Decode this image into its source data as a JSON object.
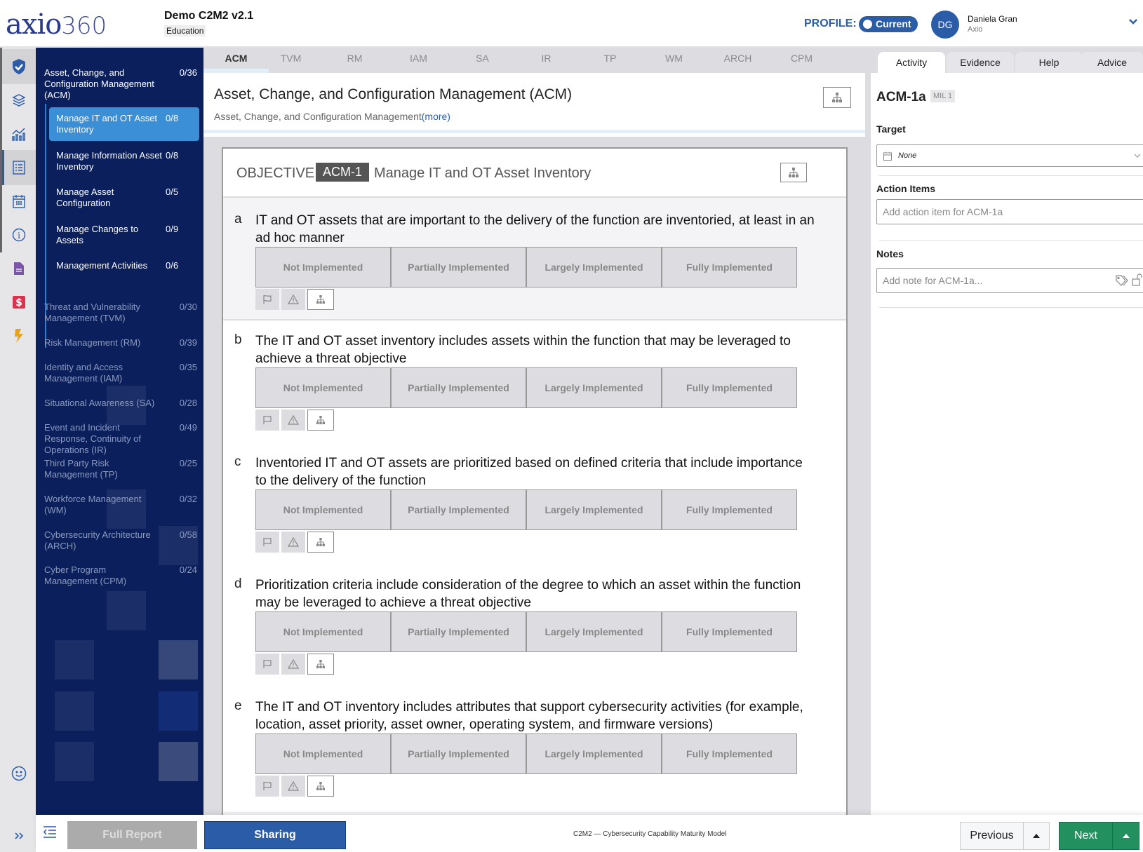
{
  "header": {
    "logo_main": "axio",
    "logo_num": "360",
    "project_title": "Demo C2M2 v2.1",
    "project_tag": "Education",
    "profile_label": "PROFILE:",
    "profile_value": "Current",
    "user_initials": "DG",
    "user_name": "Daniela Gran",
    "user_org": "Axio"
  },
  "rail": {
    "icons": [
      "shield-check-icon",
      "layers-icon",
      "chart-icon",
      "checklist-icon",
      "calendar-icon",
      "info-icon",
      "document-icon",
      "dollar-icon",
      "bolt-icon",
      "smiley-icon",
      "expand-icon"
    ]
  },
  "sidenav": {
    "active_domain": {
      "label": "Asset, Change, and Configuration Management (ACM)",
      "count": "0/36"
    },
    "objectives": [
      {
        "label": "Manage IT and OT Asset Inventory",
        "count": "0/8",
        "active": true
      },
      {
        "label": "Manage Information Asset Inventory",
        "count": "0/8"
      },
      {
        "label": "Manage Asset Configuration",
        "count": "0/5"
      },
      {
        "label": "Manage Changes to Assets",
        "count": "0/9"
      },
      {
        "label": "Management Activities",
        "count": "0/6"
      }
    ],
    "domains": [
      {
        "label": "Threat and Vulnerability Management (TVM)",
        "count": "0/30"
      },
      {
        "label": "Risk Management (RM)",
        "count": "0/39"
      },
      {
        "label": "Identity and Access Management (IAM)",
        "count": "0/35"
      },
      {
        "label": "Situational Awareness (SA)",
        "count": "0/28"
      },
      {
        "label": "Event and Incident Response, Continuity of Operations (IR)",
        "count": "0/49"
      },
      {
        "label": "Third Party Risk Management (TP)",
        "count": "0/25"
      },
      {
        "label": "Workforce Management (WM)",
        "count": "0/32"
      },
      {
        "label": "Cybersecurity Architecture (ARCH)",
        "count": "0/58"
      },
      {
        "label": "Cyber Program Management (CPM)",
        "count": "0/24"
      }
    ]
  },
  "tabs": [
    "ACM",
    "TVM",
    "RM",
    "IAM",
    "SA",
    "IR",
    "TP",
    "WM",
    "ARCH",
    "CPM"
  ],
  "active_tab": "ACM",
  "main": {
    "title": "Asset, Change, and Configuration Management (ACM)",
    "subtitle": "Asset, Change, and Configuration Management",
    "more_link": "(more)",
    "objective_label": "OBJECTIVE",
    "objective_code": "ACM-1",
    "objective_name": "Manage IT and OT Asset Inventory",
    "response_options": [
      "Not Implemented",
      "Partially Implemented",
      "Largely Implemented",
      "Fully Implemented"
    ],
    "practices": [
      {
        "letter": "a",
        "text": "IT and OT assets that are important to the delivery of the function are inventoried, at least in an ad hoc manner"
      },
      {
        "letter": "b",
        "text": "The IT and OT asset inventory includes assets within the function that may be leveraged to achieve a threat objective"
      },
      {
        "letter": "c",
        "text": "Inventoried IT and OT assets are prioritized based on defined criteria that include importance to the delivery of the function"
      },
      {
        "letter": "d",
        "text": "Prioritization criteria include consideration of the degree to which an asset within the function may be leveraged to achieve a threat objective"
      },
      {
        "letter": "e",
        "text": "The IT and OT inventory includes attributes that support cybersecurity activities (for example, location, asset priority, asset owner, operating system, and firmware versions)"
      }
    ]
  },
  "right_panel": {
    "tabs": [
      "Activity",
      "Evidence",
      "Help",
      "Advice"
    ],
    "active_tab": "Activity",
    "practice_code": "ACM-1a",
    "mil": "MIL 1",
    "target_label": "Target",
    "target_value": "None",
    "action_items_label": "Action Items",
    "action_items_placeholder": "Add action item for ACM-1a",
    "notes_label": "Notes",
    "notes_placeholder": "Add note for ACM-1a..."
  },
  "footer": {
    "full_report": "Full Report",
    "sharing": "Sharing",
    "model_name": "C2M2 — Cybersecurity Capability Maturity Model",
    "previous": "Previous",
    "next": "Next"
  },
  "colors": {
    "brand_blue": "#2a5ca8",
    "nav_bg": "#0a1f5c",
    "nav_active": "#3b8fd6",
    "next_green": "#239060"
  }
}
